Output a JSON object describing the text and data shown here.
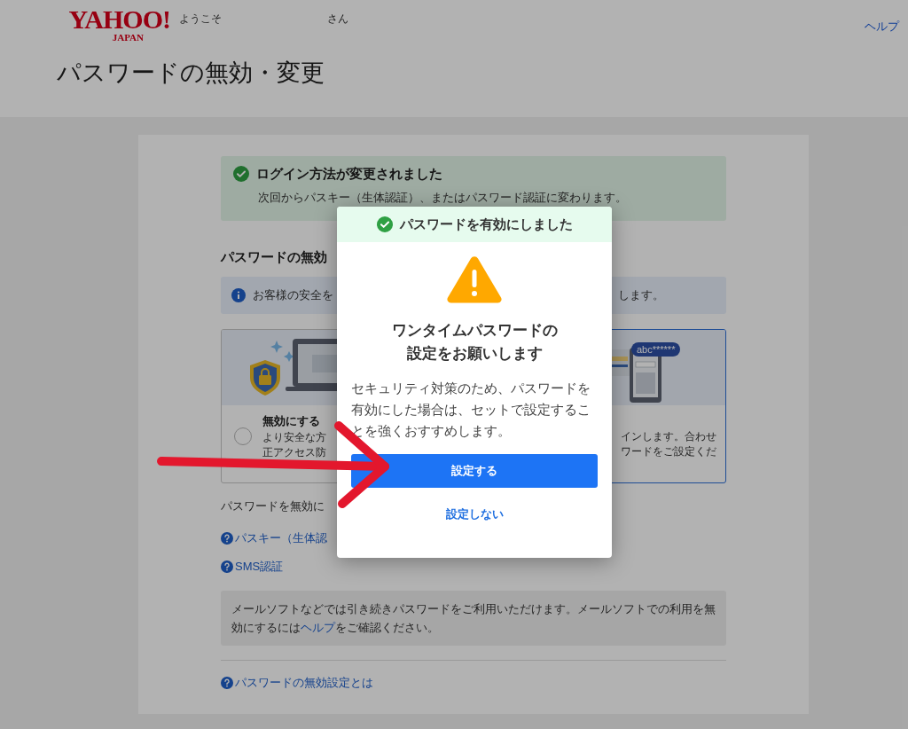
{
  "header": {
    "logo": {
      "main": "YAHOO!",
      "sub": "JAPAN"
    },
    "welcome_prefix": "ようこそ",
    "welcome_suffix": "さん",
    "help_link": "ヘルプ"
  },
  "page_title": "パスワードの無効・変更",
  "success_banner": {
    "title": "ログイン方法が変更されました",
    "message": "次回からパスキー（生体認証）、またはパスワード認証に変わります。"
  },
  "section_heading": "パスワードの無効",
  "info_box": {
    "text_left": "お客様の安全を",
    "text_right": "します。"
  },
  "options": [
    {
      "selected": false,
      "title": "無効にする",
      "lines": [
        "より安全な方",
        "正アクセス防"
      ]
    },
    {
      "selected": true,
      "lines": [
        "インします。合わせ",
        "ワードをご設定くだ"
      ],
      "bubble": "abc******"
    }
  ],
  "notice": "パスワードを無効に",
  "links": [
    "パスキー（生体認",
    "SMS認証"
  ],
  "mail_note": {
    "before": "メールソフトなどでは引き続きパスワードをご利用いただけます。メールソフトでの利用を無効にするには",
    "link": "ヘルプ",
    "after": "をご確認ください。"
  },
  "footer_link": "パスワードの無効設定とは",
  "dialog": {
    "status": "パスワードを有効にしました",
    "title_lines": [
      "ワンタイムパスワードの",
      "設定をお願いします"
    ],
    "body": "セキュリティ対策のため、パスワードを有効にした場合は、セットで設定することを強くおすすめします。",
    "primary_button": "設定する",
    "secondary_button": "設定しない"
  }
}
